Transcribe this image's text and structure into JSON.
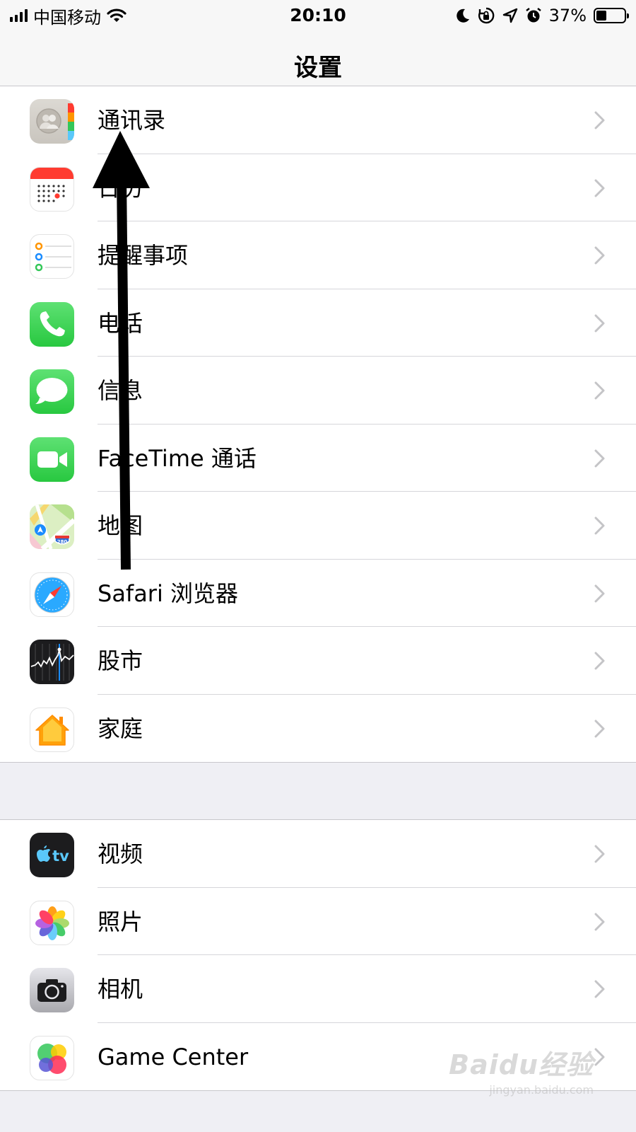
{
  "status_bar": {
    "carrier": "中国移动",
    "time": "20:10",
    "battery_percent": "37%",
    "battery_level": 0.37
  },
  "nav": {
    "title": "设置"
  },
  "group1": [
    {
      "label": "通讯录",
      "icon": "contacts-icon"
    },
    {
      "label": "日历",
      "icon": "calendar-icon"
    },
    {
      "label": "提醒事项",
      "icon": "reminders-icon"
    },
    {
      "label": "电话",
      "icon": "phone-icon"
    },
    {
      "label": "信息",
      "icon": "messages-icon"
    },
    {
      "label": "FaceTime 通话",
      "icon": "facetime-icon"
    },
    {
      "label": "地图",
      "icon": "maps-icon"
    },
    {
      "label": "Safari 浏览器",
      "icon": "safari-icon"
    },
    {
      "label": "股市",
      "icon": "stocks-icon"
    },
    {
      "label": "家庭",
      "icon": "home-icon"
    }
  ],
  "group2": [
    {
      "label": "视频",
      "icon": "tv-icon"
    },
    {
      "label": "照片",
      "icon": "photos-icon"
    },
    {
      "label": "相机",
      "icon": "camera-icon"
    },
    {
      "label": "Game Center",
      "icon": "game-center-icon"
    }
  ],
  "icons_text": {
    "tv": "tv",
    "maps_shield": "280"
  },
  "watermark": {
    "brand": "Baidu经验",
    "url": "jingyan.baidu.com"
  },
  "colors": {
    "phone_green": "#34c759",
    "calendar_red": "#ff3b30",
    "home_orange": "#ff9f0a",
    "safari_blue": "#1a8cff"
  }
}
